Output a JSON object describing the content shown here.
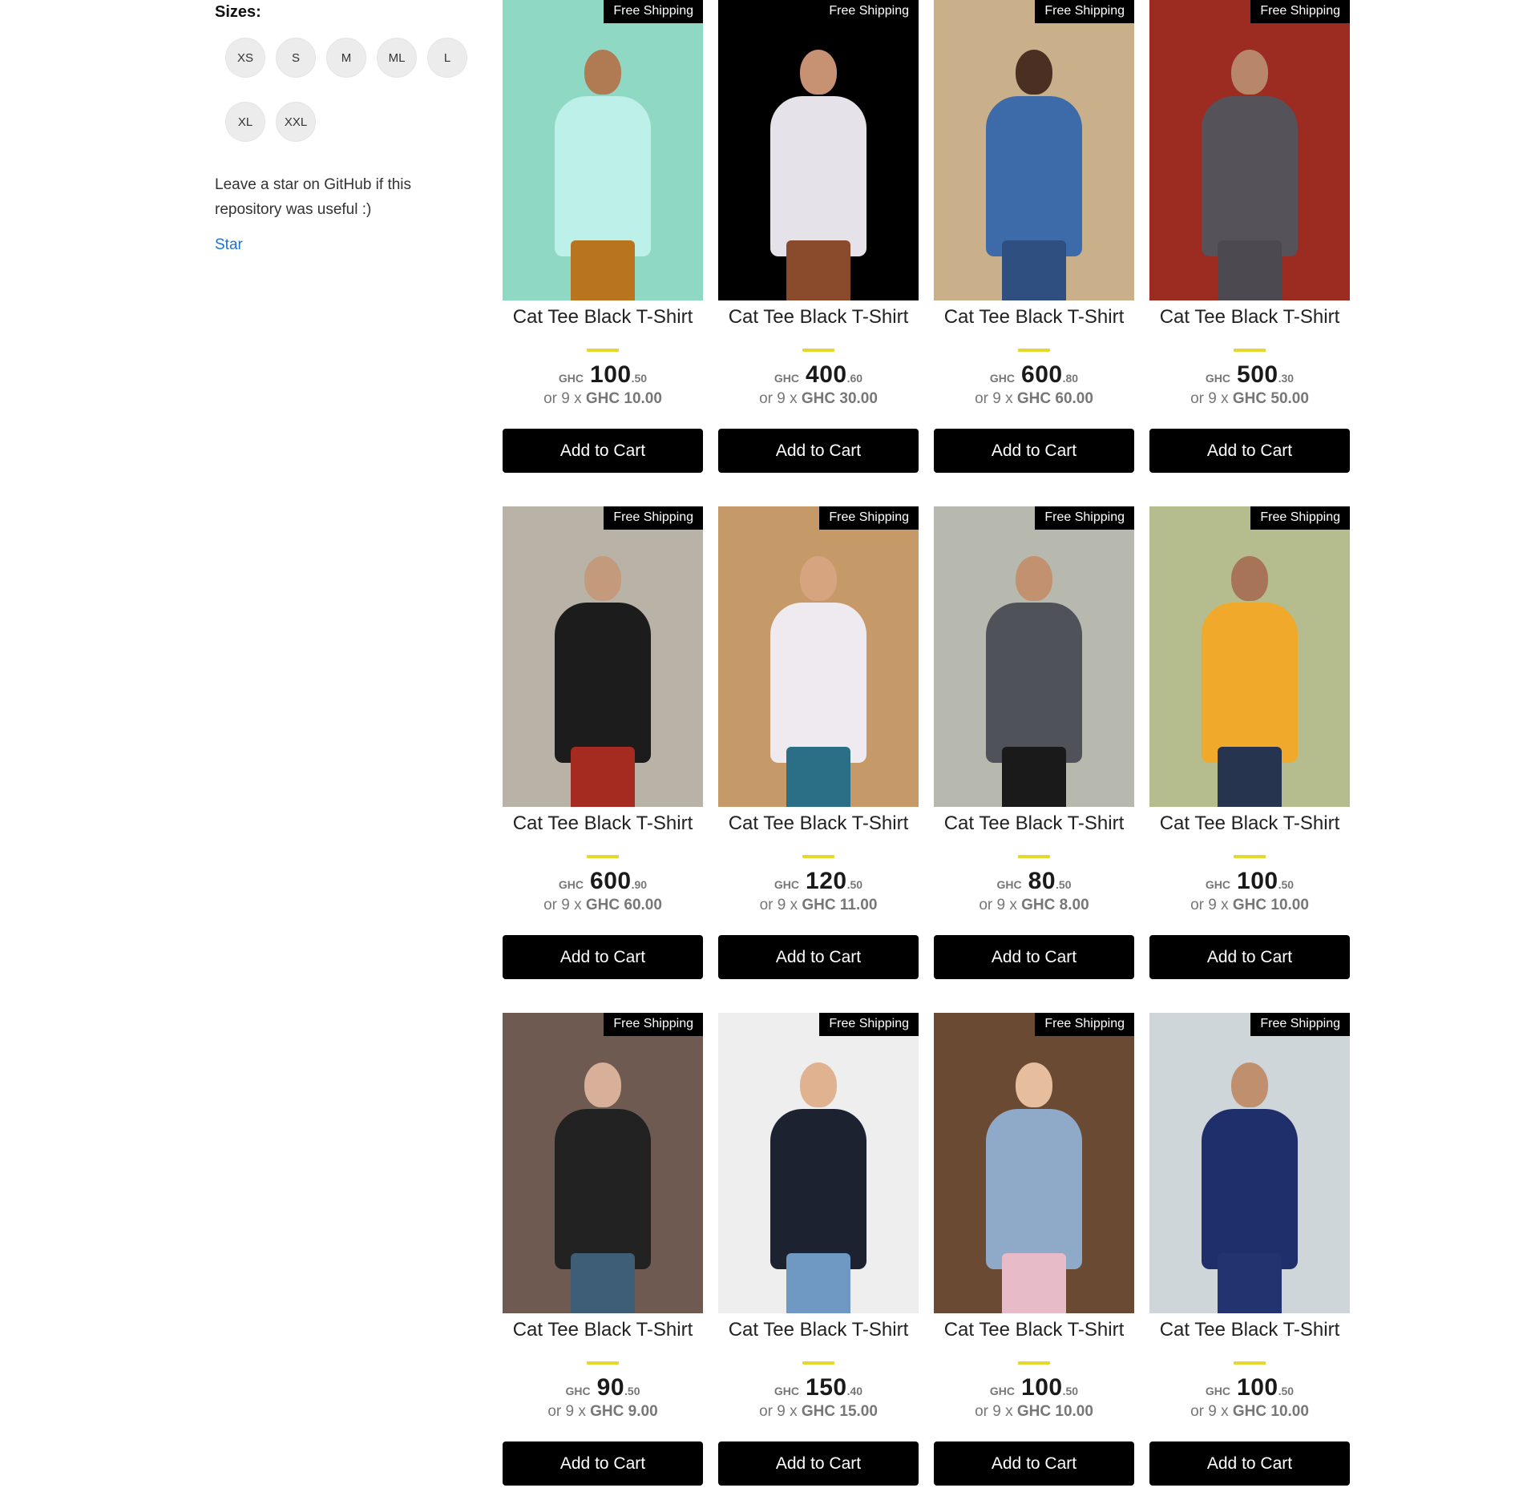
{
  "filters": {
    "sizes_title": "Sizes:",
    "sizes": [
      "XS",
      "S",
      "M",
      "ML",
      "L",
      "XL",
      "XXL"
    ]
  },
  "github": {
    "message": "Leave a star on GitHub if this repository was useful :)",
    "star_label": "Star"
  },
  "colors": {
    "accent_dash": "#e3d82b",
    "link": "#1e73c9",
    "button_bg": "#000000"
  },
  "products": [
    {
      "badge": "Free Shipping",
      "title": "Cat Tee Black T-Shirt",
      "currency": "GHC",
      "price_int": "100",
      "price_dec": ".50",
      "inst_prefix": "or 9 x",
      "inst_value": "GHC 10.00",
      "cta": "Add to Cart",
      "photo": {
        "bg": "#8fd8c3",
        "shirt": "#bdf0e8",
        "legs": "#b8741f",
        "head": "#b07a52"
      }
    },
    {
      "badge": "Free Shipping",
      "title": "Cat Tee Black T-Shirt",
      "currency": "GHC",
      "price_int": "400",
      "price_dec": ".60",
      "inst_prefix": "or 9 x",
      "inst_value": "GHC 30.00",
      "cta": "Add to Cart",
      "photo": {
        "bg": "#000000",
        "shirt": "#e6e2ea",
        "legs": "#8a4a2c",
        "head": "#c79274"
      }
    },
    {
      "badge": "Free Shipping",
      "title": "Cat Tee Black T-Shirt",
      "currency": "GHC",
      "price_int": "600",
      "price_dec": ".80",
      "inst_prefix": "or 9 x",
      "inst_value": "GHC 60.00",
      "cta": "Add to Cart",
      "photo": {
        "bg": "#c9b08a",
        "shirt": "#3d6aa8",
        "legs": "#2f4f80",
        "head": "#4a2f22"
      }
    },
    {
      "badge": "Free Shipping",
      "title": "Cat Tee Black T-Shirt",
      "currency": "GHC",
      "price_int": "500",
      "price_dec": ".30",
      "inst_prefix": "or 9 x",
      "inst_value": "GHC 50.00",
      "cta": "Add to Cart",
      "photo": {
        "bg": "#9c2b22",
        "shirt": "#55525a",
        "legs": "#4c4a50",
        "head": "#b8876a"
      }
    },
    {
      "badge": "Free Shipping",
      "title": "Cat Tee Black T-Shirt",
      "currency": "GHC",
      "price_int": "600",
      "price_dec": ".90",
      "inst_prefix": "or 9 x",
      "inst_value": "GHC 60.00",
      "cta": "Add to Cart",
      "photo": {
        "bg": "#b9b2a6",
        "shirt": "#1c1c1c",
        "legs": "#a52a1f",
        "head": "#c49a7c"
      }
    },
    {
      "badge": "Free Shipping",
      "title": "Cat Tee Black T-Shirt",
      "currency": "GHC",
      "price_int": "120",
      "price_dec": ".50",
      "inst_prefix": "or 9 x",
      "inst_value": "GHC 11.00",
      "cta": "Add to Cart",
      "photo": {
        "bg": "#c59a68",
        "shirt": "#efeaf0",
        "legs": "#2a6f85",
        "head": "#d6a47f"
      }
    },
    {
      "badge": "Free Shipping",
      "title": "Cat Tee Black T-Shirt",
      "currency": "GHC",
      "price_int": "80",
      "price_dec": ".50",
      "inst_prefix": "or 9 x",
      "inst_value": "GHC 8.00",
      "cta": "Add to Cart",
      "photo": {
        "bg": "#b7b9ae",
        "shirt": "#4f5359",
        "legs": "#1a1a1a",
        "head": "#c2916f"
      }
    },
    {
      "badge": "Free Shipping",
      "title": "Cat Tee Black T-Shirt",
      "currency": "GHC",
      "price_int": "100",
      "price_dec": ".50",
      "inst_prefix": "or 9 x",
      "inst_value": "GHC 10.00",
      "cta": "Add to Cart",
      "photo": {
        "bg": "#b5bd8e",
        "shirt": "#f0a92b",
        "legs": "#27344f",
        "head": "#a77457"
      }
    },
    {
      "badge": "Free Shipping",
      "title": "Cat Tee Black T-Shirt",
      "currency": "GHC",
      "price_int": "90",
      "price_dec": ".50",
      "inst_prefix": "or 9 x",
      "inst_value": "GHC 9.00",
      "cta": "Add to Cart",
      "photo": {
        "bg": "#6e5a50",
        "shirt": "#222222",
        "legs": "#3e5e78",
        "head": "#d8b09a"
      }
    },
    {
      "badge": "Free Shipping",
      "title": "Cat Tee Black T-Shirt",
      "currency": "GHC",
      "price_int": "150",
      "price_dec": ".40",
      "inst_prefix": "or 9 x",
      "inst_value": "GHC 15.00",
      "cta": "Add to Cart",
      "photo": {
        "bg": "#eeeeee",
        "shirt": "#1c2230",
        "legs": "#6f98c2",
        "head": "#e0b290"
      }
    },
    {
      "badge": "Free Shipping",
      "title": "Cat Tee Black T-Shirt",
      "currency": "GHC",
      "price_int": "100",
      "price_dec": ".50",
      "inst_prefix": "or 9 x",
      "inst_value": "GHC 10.00",
      "cta": "Add to Cart",
      "photo": {
        "bg": "#6b4a34",
        "shirt": "#8fa9c8",
        "legs": "#e7bcc8",
        "head": "#e6be9e"
      }
    },
    {
      "badge": "Free Shipping",
      "title": "Cat Tee Black T-Shirt",
      "currency": "GHC",
      "price_int": "100",
      "price_dec": ".50",
      "inst_prefix": "or 9 x",
      "inst_value": "GHC 10.00",
      "cta": "Add to Cart",
      "photo": {
        "bg": "#cfd6d9",
        "shirt": "#1f2f6b",
        "legs": "#223470",
        "head": "#c08f6d"
      }
    }
  ]
}
